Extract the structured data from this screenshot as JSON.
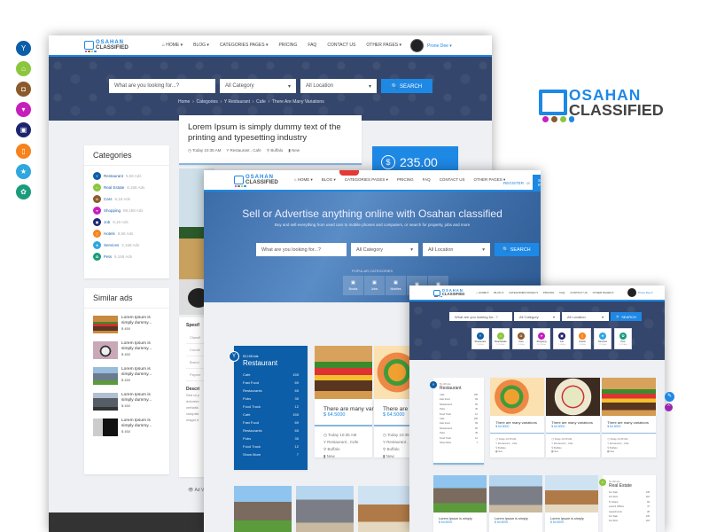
{
  "side_icons": [
    {
      "icon": "cocktail-icon",
      "color": "#0d5ea8",
      "glyph": "Y"
    },
    {
      "icon": "home-icon",
      "color": "#8cc63f",
      "glyph": "⌂"
    },
    {
      "icon": "car-icon",
      "color": "#8b5a2b",
      "glyph": "◘"
    },
    {
      "icon": "cart-icon",
      "color": "#c71fbd",
      "glyph": "▾"
    },
    {
      "icon": "briefcase-icon",
      "color": "#1c2470",
      "glyph": "▣"
    },
    {
      "icon": "tablet-icon",
      "color": "#f7821b",
      "glyph": "▯"
    },
    {
      "icon": "star-icon",
      "color": "#2ea7e0",
      "glyph": "★"
    },
    {
      "icon": "paw-icon",
      "color": "#1a9c7b",
      "glyph": "✿"
    }
  ],
  "brand": {
    "line1": "OSAHAN",
    "line2": "CLASSIFIED",
    "dot_colors": [
      "#c71fbd",
      "#8b5a2b",
      "#8cc63f",
      "#1e88e5"
    ],
    "accent": "#1e88e5",
    "navy": "#34466b"
  },
  "nav": {
    "items": [
      "⌂ HOME ▾",
      "BLOG ▾",
      "CATEGORIES PAGES ▾",
      "PRICING",
      "FAQ",
      "CONTACT US",
      "OTHER PAGES ▾"
    ],
    "user": "Prone Dee ▾",
    "register": "REGISTER",
    "or": "or",
    "signin": "SIGN IN"
  },
  "search": {
    "placeholder": "What are you looking for...?",
    "category": "All Category",
    "location": "All Location",
    "button": "🔍 SEARCH"
  },
  "detail": {
    "breadcrumb": "Home  ›  Categories  ›  Y Restaurant  ›  Cafe  ›  There Are Many Variations",
    "title": "Lorem Ipsum is simply dummy text of the printing and typesetting industry",
    "meta": [
      "◷ Today 10:35 AM",
      "Y Restaurant , Cafe",
      "⚲ Buffalo",
      "▮ New"
    ],
    "price": "235.00",
    "currency": "$",
    "categories_title": "Categories",
    "categories": [
      {
        "name": "Restaurant",
        "count": "5,58 Ads"
      },
      {
        "name": "Real Estate",
        "count": "8,158 Ads"
      },
      {
        "name": "Cars",
        "count": "6,18 Ads"
      },
      {
        "name": "Shopping",
        "count": "98,158 Ads"
      },
      {
        "name": "Job",
        "count": "9,18 Ads"
      },
      {
        "name": "Hotels",
        "count": "8,58 Ads"
      },
      {
        "name": "Services",
        "count": "2,158 Ads"
      },
      {
        "name": "Pets",
        "count": "9,158 Ads"
      }
    ],
    "similar_title": "Similar ads",
    "similar": [
      {
        "text": "Lorem Ipsum is simply dummy...",
        "price": "$ 450",
        "img": "burger"
      },
      {
        "text": "Lorem Ipsum is simply dummy...",
        "price": "$ 450",
        "img": "cat"
      },
      {
        "text": "Lorem Ipsum is simply dummy...",
        "price": "$ 450",
        "img": "house"
      },
      {
        "text": "Lorem Ipsum is simply dummy...",
        "price": "$ 450",
        "img": "car"
      },
      {
        "text": "Lorem Ipsum is simply dummy...",
        "price": "$ 450",
        "img": "phone"
      }
    ],
    "spec_title": "Spesif",
    "specs": [
      "Classif",
      "Condit",
      "Brand",
      "Payme"
    ],
    "desc_title": "Descri",
    "desc": "Sed ut p dolorem veritatis voluptat magni d",
    "ad_views": "👁 Ad V"
  },
  "home": {
    "headline": "Sell or Advertise anything online with Osahan classified",
    "sub": "Buy and sell everything from used cars to mobile phones and computers, or search for property, jobs and more",
    "popular": "POPULAR CATEGORIES",
    "popular_items": [
      "Books",
      "Jobs",
      "Mobiles",
      "",
      ""
    ],
    "restaurant": {
      "count": "50,198 Ads",
      "title": "Restaurant",
      "items": [
        [
          "Cafe",
          "155"
        ],
        [
          "Fast Food",
          "69"
        ],
        [
          "Restaurants",
          "65"
        ],
        [
          "Pubs",
          "35"
        ],
        [
          "Food Truck",
          "12"
        ],
        [
          "Cafe",
          "155"
        ],
        [
          "Fast Food",
          "69"
        ],
        [
          "Restaurants",
          "65"
        ],
        [
          "Pubs",
          "35"
        ],
        [
          "Food Truck",
          "12"
        ],
        [
          "Show More",
          "7"
        ]
      ]
    },
    "cards": [
      {
        "title": "There are many variations",
        "price": "$ 64.5000",
        "meta": [
          "◷ Today 10:35 AM",
          "Y Restaurant , Cafe",
          "⚲ Buffalo",
          "▮ New"
        ]
      },
      {
        "title": "There are many variations",
        "price": "$ 64.5000",
        "meta": [
          "◷ Today 10:35 AM",
          "Y Restaurant , Cafe",
          "⚲ Buffalo",
          "▮ New"
        ]
      },
      {
        "title": "There are many variations",
        "price": "$ 64.5000",
        "meta": [
          "◷ Today 10:35 AM",
          "Y Restaurant , Cafe",
          "⚲ Buffalo",
          "▮ New"
        ]
      }
    ]
  },
  "list": {
    "tiles": [
      {
        "name": "Restaurant",
        "count": "5,58 Ads"
      },
      {
        "name": "Real Estate",
        "count": "8,158 Ads"
      },
      {
        "name": "Cars",
        "count": "6,18 Ads"
      },
      {
        "name": "Shopping",
        "count": "98,158 Ads"
      },
      {
        "name": "Job",
        "count": "9,18 Ads"
      },
      {
        "name": "Hotels",
        "count": "8,58 Ads"
      },
      {
        "name": "Services",
        "count": "2,158 Ads"
      },
      {
        "name": "Pets",
        "count": "9,158 Ads"
      }
    ],
    "houses": [
      {
        "title": "Lorem Ipsum is simply",
        "price": "$ 64.5000"
      },
      {
        "title": "Lorem Ipsum is simply",
        "price": "$ 64.5000"
      },
      {
        "title": "Lorem Ipsum is simply",
        "price": "$ 64.5000"
      }
    ],
    "real_estate": {
      "count": "50,198 Ads",
      "title": "Real Estate",
      "items": [
        [
          "For Sale",
          "135"
        ],
        [
          "For Rent",
          "118"
        ],
        [
          "To Share",
          "65"
        ],
        [
          "Land & Offices",
          "47"
        ],
        [
          "Appartments",
          "28"
        ],
        [
          "For Sale",
          "135"
        ],
        [
          "For Rent",
          "118"
        ]
      ]
    }
  }
}
